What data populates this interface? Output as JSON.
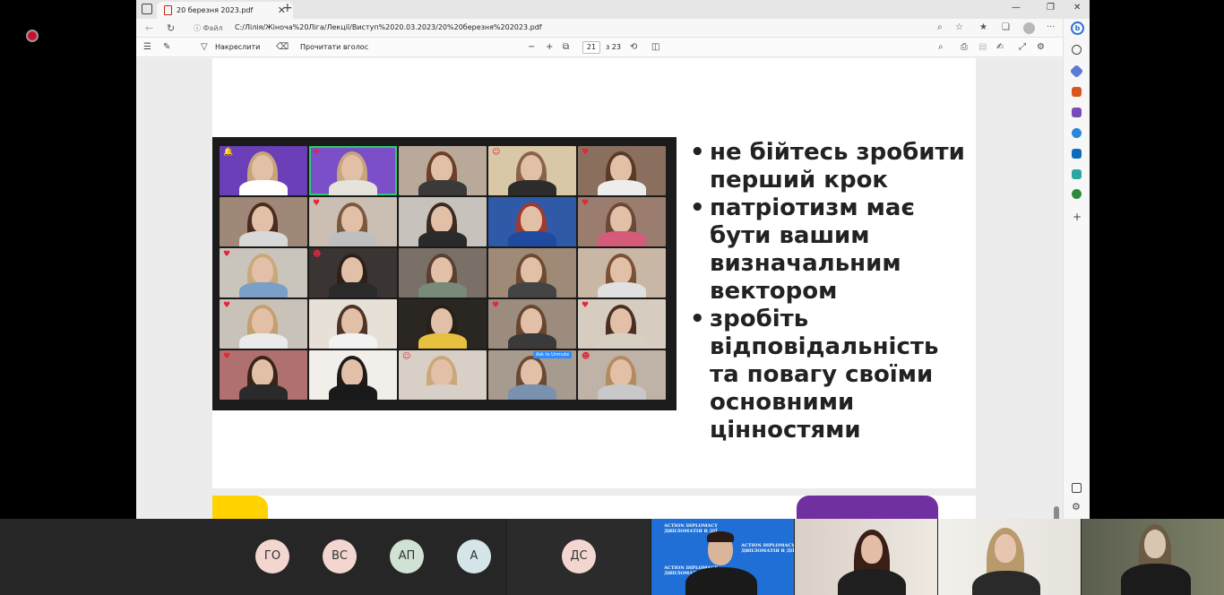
{
  "browser": {
    "tab_title": "20 березня 2023.pdf",
    "tab_close": "✕",
    "new_tab": "+",
    "window_min": "—",
    "window_max": "❐",
    "window_close": "✕",
    "back": "←",
    "reload": "↻",
    "info_label": "ⓘ Файл",
    "url": "C:/Лілія/Жіноча%20Ліга/Лекції/Виступ%2020.03.2023/20%20березня%202023.pdf",
    "more": "···"
  },
  "pdf_toolbar": {
    "contents": "☰",
    "highlight": "✎",
    "draw_label": "Накреслити",
    "eraser": "⌫",
    "read_aloud_label": "Прочитати вголос",
    "zoom_out": "−",
    "zoom_in": "+",
    "page_current": "21",
    "page_total": "з 23",
    "rotate": "⟲",
    "search": "⌕",
    "print": "⎙",
    "settings": "⚙"
  },
  "slide": {
    "bullets": [
      "не бійтесь зробити перший крок",
      "патріотизм має бути вашим визначальним вектором",
      "зробіть відповідальність та повагу своїми основними цінностями"
    ],
    "ask_tag": "Ask to Unmute"
  },
  "edge_sidebar": {
    "copilot": "b",
    "add": "+"
  },
  "participants": {
    "initials": [
      "ГО",
      "ВС",
      "АП",
      "А",
      "ДС"
    ],
    "ad_line1": "ACTION DIPLOMACY",
    "ad_line2": "ДИПЛОМАТІЯ В ДІЇ"
  },
  "colors": {
    "accent_yellow": "#ffd200",
    "accent_purple": "#7030a0",
    "zoom_blue": "#2d8cff",
    "record_red": "#c8102e"
  }
}
